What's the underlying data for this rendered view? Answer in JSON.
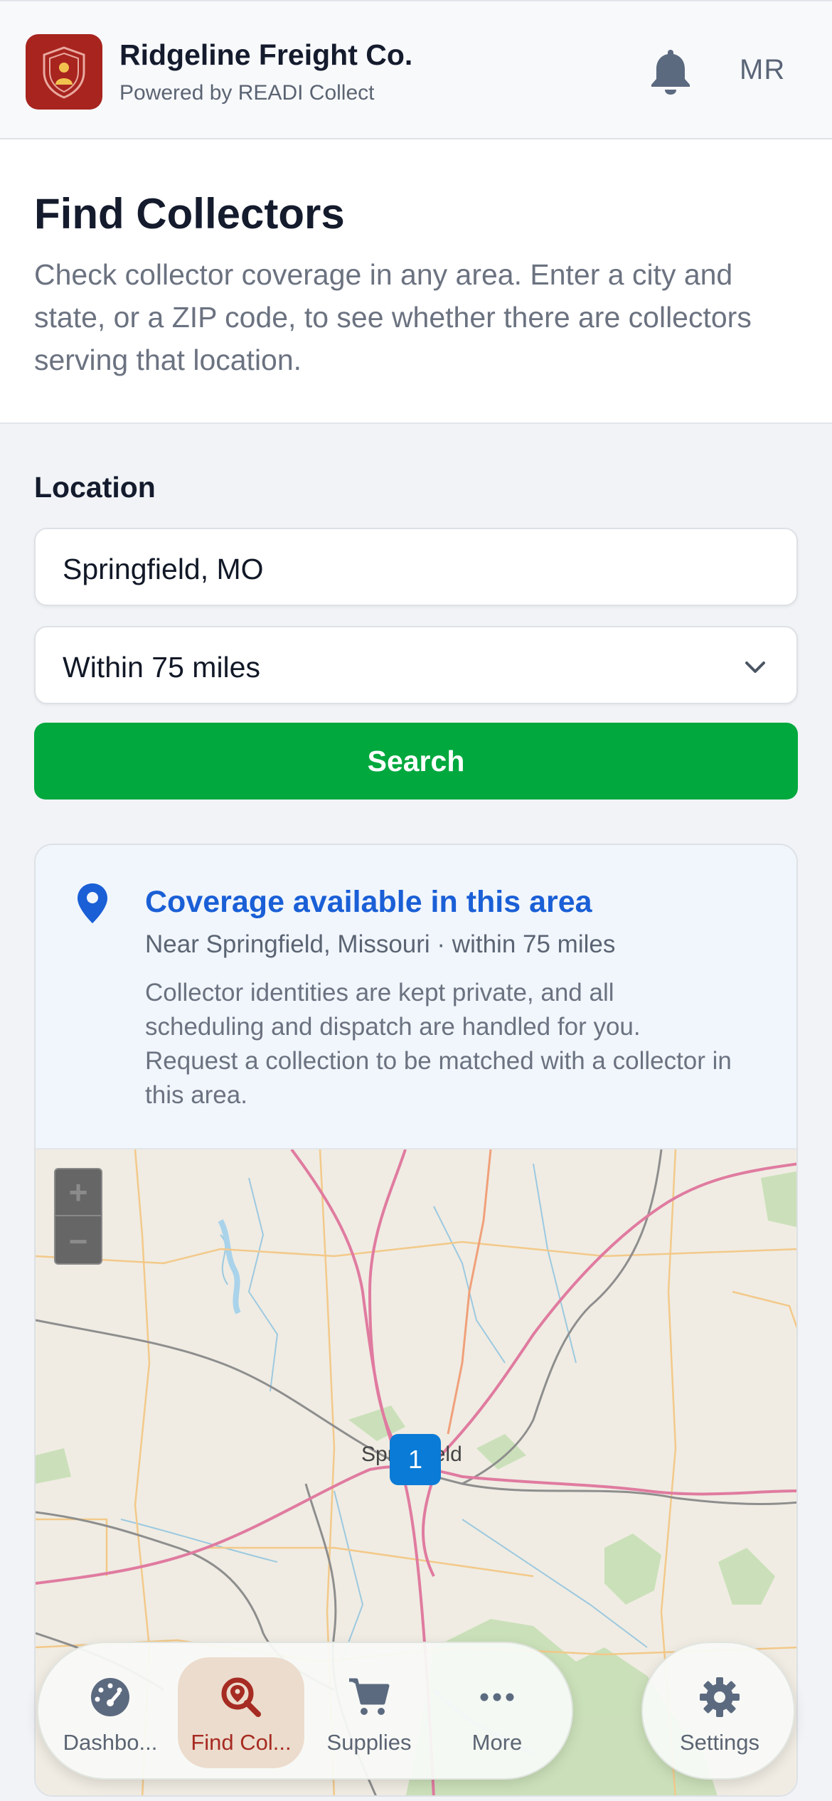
{
  "header": {
    "company_name": "Ridgeline Freight Co.",
    "powered_by": "Powered by READI Collect",
    "user_initials": "MR"
  },
  "intro": {
    "title": "Find Collectors",
    "description": "Check collector coverage in any area. Enter a city and state, or a ZIP code, to see whether there are collectors serving that location."
  },
  "form": {
    "location_label": "Location",
    "location_value": "Springfield, MO",
    "radius_selected": "Within 75 miles",
    "search_label": "Search"
  },
  "result": {
    "title": "Coverage available in this area",
    "location_line": "Near Springfield, Missouri · within 75 miles",
    "body": "Collector identities are kept private, and all scheduling and dispatch are handled for you. Request a collection to be matched with a collector in this area."
  },
  "map": {
    "zoom_in": "+",
    "zoom_out": "−",
    "city_label": "Springfield",
    "marker_count": "1"
  },
  "nav": {
    "items": [
      {
        "label": "Dashbo...",
        "icon": "gauge-icon",
        "active": false
      },
      {
        "label": "Find Col...",
        "icon": "search-location-icon",
        "active": true
      },
      {
        "label": "Supplies",
        "icon": "cart-icon",
        "active": false
      },
      {
        "label": "More",
        "icon": "more-icon",
        "active": false
      }
    ],
    "settings_label": "Settings"
  },
  "colors": {
    "brand_red": "#a8241e",
    "search_green": "#00a83e",
    "link_blue": "#1a5fd6",
    "marker_blue": "#0a7bd6"
  }
}
